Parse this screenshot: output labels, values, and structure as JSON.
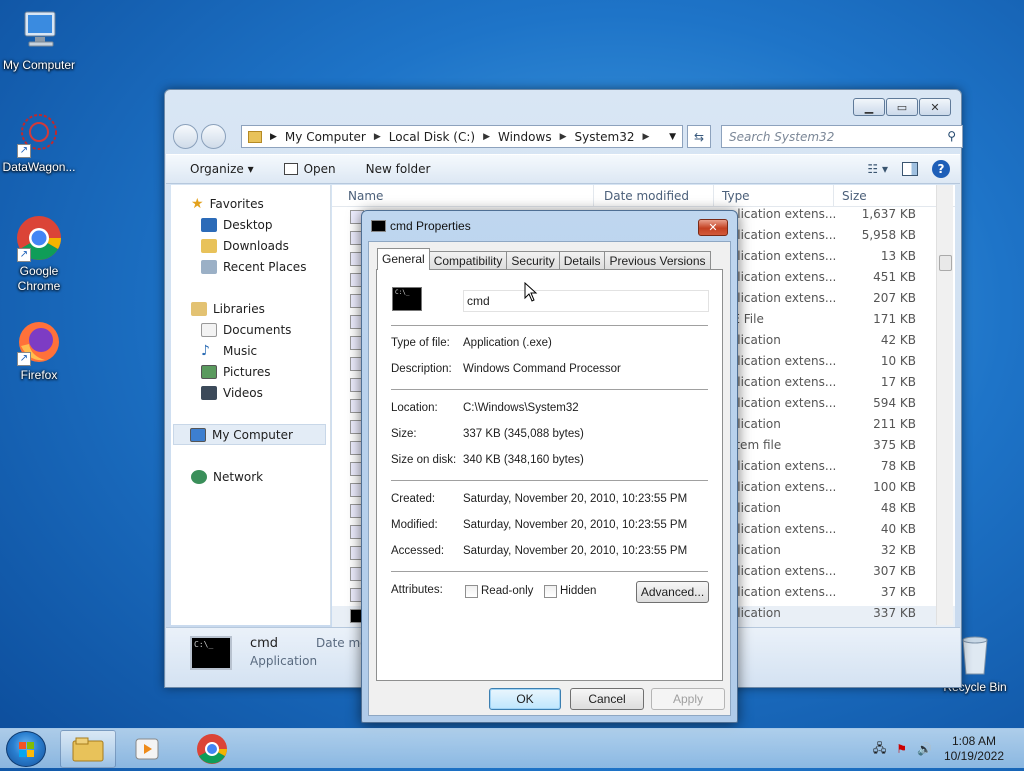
{
  "desktop": {
    "icons": [
      {
        "label": "My Computer"
      },
      {
        "label": "DataWagon..."
      },
      {
        "label": "Google Chrome"
      },
      {
        "label": "Firefox"
      },
      {
        "label": "Recycle Bin"
      }
    ]
  },
  "explorer": {
    "breadcrumb": [
      "My Computer",
      "Local Disk (C:)",
      "Windows",
      "System32"
    ],
    "search_placeholder": "Search System32",
    "toolbar": {
      "organize": "Organize ▾",
      "open": "Open",
      "new_folder": "New folder"
    },
    "nav": {
      "favorites": "Favorites",
      "desktop": "Desktop",
      "downloads": "Downloads",
      "recent": "Recent Places",
      "libraries": "Libraries",
      "documents": "Documents",
      "music": "Music",
      "pictures": "Pictures",
      "videos": "Videos",
      "my_computer": "My Computer",
      "network": "Network"
    },
    "columns": {
      "name": "Name",
      "modified": "Date modified",
      "type": "Type",
      "size": "Size"
    },
    "rows": [
      {
        "type": "pplication extens...",
        "size": "1,637 KB"
      },
      {
        "type": "pplication extens...",
        "size": "5,958 KB"
      },
      {
        "type": "pplication extens...",
        "size": "13 KB"
      },
      {
        "type": "pplication extens...",
        "size": "451 KB"
      },
      {
        "type": "pplication extens...",
        "size": "207 KB"
      },
      {
        "type": "ME File",
        "size": "171 KB"
      },
      {
        "type": "pplication",
        "size": "42 KB"
      },
      {
        "type": "pplication extens...",
        "size": "10 KB"
      },
      {
        "type": "pplication extens...",
        "size": "17 KB"
      },
      {
        "type": "pplication extens...",
        "size": "594 KB"
      },
      {
        "type": "pplication",
        "size": "211 KB"
      },
      {
        "type": "ystem file",
        "size": "375 KB"
      },
      {
        "type": "pplication extens...",
        "size": "78 KB"
      },
      {
        "type": "pplication extens...",
        "size": "100 KB"
      },
      {
        "type": "pplication",
        "size": "48 KB"
      },
      {
        "type": "pplication extens...",
        "size": "40 KB"
      },
      {
        "type": "pplication",
        "size": "32 KB"
      },
      {
        "type": "pplication extens...",
        "size": "307 KB"
      },
      {
        "type": "pplication extens...",
        "size": "37 KB"
      },
      {
        "type": "pplication",
        "size": "337 KB"
      }
    ],
    "details": {
      "name": "cmd",
      "type": "Application",
      "modified_label": "Date mo"
    }
  },
  "dialog": {
    "title": "cmd Properties",
    "tabs": [
      "General",
      "Compatibility",
      "Security",
      "Details",
      "Previous Versions"
    ],
    "filename": "cmd",
    "type_label": "Type of file:",
    "type_value": "Application (.exe)",
    "desc_label": "Description:",
    "desc_value": "Windows Command Processor",
    "loc_label": "Location:",
    "loc_value": "C:\\Windows\\System32",
    "size_label": "Size:",
    "size_value": "337 KB (345,088 bytes)",
    "disk_label": "Size on disk:",
    "disk_value": "340 KB (348,160 bytes)",
    "created_label": "Created:",
    "created_value": "Saturday, November 20, 2010, 10:23:55 PM",
    "modified_label": "Modified:",
    "modified_value": "Saturday, November 20, 2010, 10:23:55 PM",
    "accessed_label": "Accessed:",
    "accessed_value": "Saturday, November 20, 2010, 10:23:55 PM",
    "attributes_label": "Attributes:",
    "readonly": "Read-only",
    "hidden": "Hidden",
    "advanced": "Advanced...",
    "ok": "OK",
    "cancel": "Cancel",
    "apply": "Apply"
  },
  "taskbar": {
    "time": "1:08 AM",
    "date": "10/19/2022"
  }
}
